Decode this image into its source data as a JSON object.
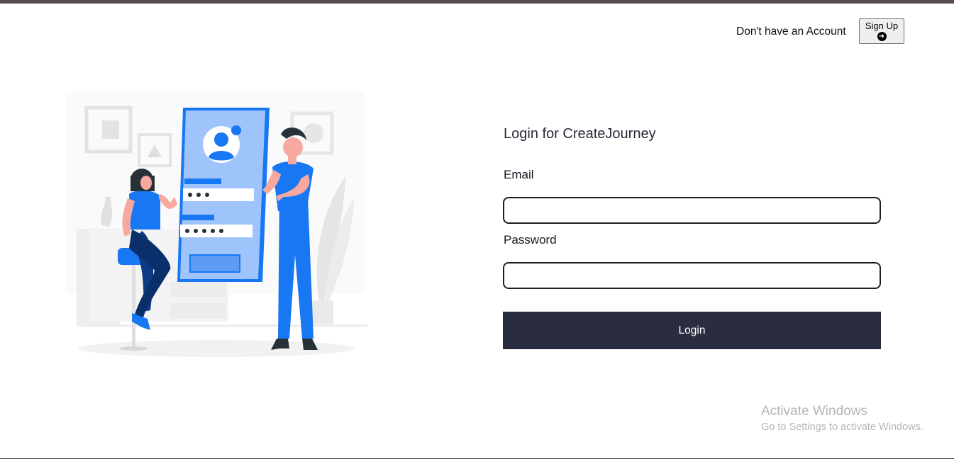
{
  "header": {
    "prompt": "Don't have an Account",
    "signup_label": "Sign Up",
    "signup_icon": "arrow-right-circle-icon"
  },
  "illustration": {
    "subject": "login-illustration",
    "accent_color": "#1877f2"
  },
  "form": {
    "title": "Login for CreateJourney",
    "email": {
      "label": "Email",
      "value": "",
      "placeholder": ""
    },
    "password": {
      "label": "Password",
      "value": "",
      "placeholder": ""
    },
    "submit_label": "Login"
  },
  "watermark": {
    "title": "Activate Windows",
    "subtitle": "Go to Settings to activate Windows."
  },
  "colors": {
    "top_bar": "#5a4d52",
    "button_bg": "#2a2d40",
    "accent": "#1877f2"
  }
}
